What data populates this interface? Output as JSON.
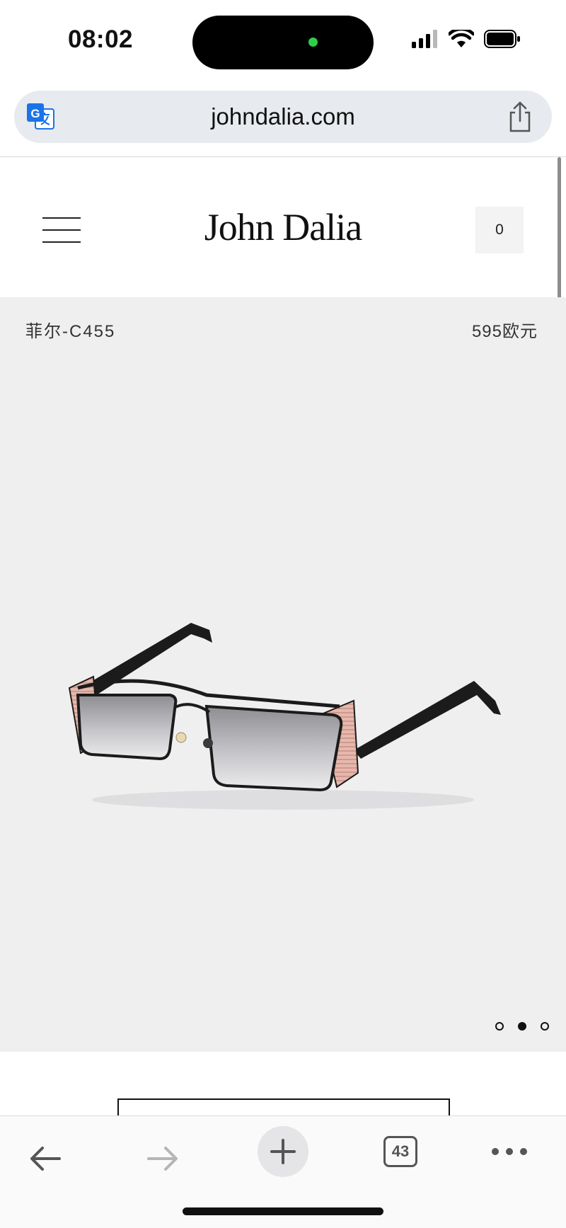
{
  "status_bar": {
    "time": "08:02"
  },
  "browser": {
    "url": "johndalia.com",
    "tab_count": "43"
  },
  "header": {
    "brand": "John Dalia",
    "cart_count": "0"
  },
  "product": {
    "name": "菲尔-C455",
    "price": "595欧元",
    "carousel": {
      "total": 3,
      "active_index": 2
    }
  },
  "colors": {
    "product_background": "#efeff0",
    "island_indicator": "#2fce4a",
    "translate_icon": "#1a73e8"
  },
  "icons": {
    "translate": "translate-icon",
    "share": "share-icon",
    "menu": "hamburger-menu-icon",
    "back": "back-arrow-icon",
    "forward": "forward-arrow-icon",
    "new_tab": "plus-icon",
    "tabs": "tabs-icon",
    "more": "more-icon"
  }
}
